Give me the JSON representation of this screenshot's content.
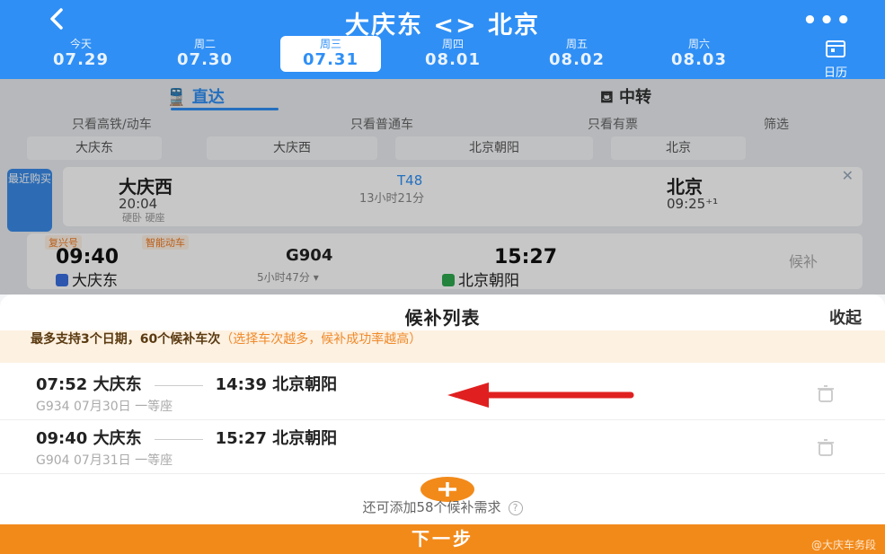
{
  "header": {
    "title": "大庆东 <> 北京",
    "more": "•••",
    "calendar_label": "日历",
    "dates": [
      {
        "weekday": "今天",
        "date": "07.29"
      },
      {
        "weekday": "周二",
        "date": "07.30"
      },
      {
        "weekday": "周三",
        "date": "07.31",
        "active": true
      },
      {
        "weekday": "周四",
        "date": "08.01"
      },
      {
        "weekday": "周五",
        "date": "08.02"
      },
      {
        "weekday": "周六",
        "date": "08.03"
      }
    ]
  },
  "background": {
    "tab_direct": "直达",
    "tab_transfer": "中转",
    "filters": [
      "只看高铁/动车",
      "只看普通车",
      "只看有票",
      "筛选"
    ],
    "stations": [
      "大庆东",
      "大庆西",
      "北京朝阳",
      "北京"
    ],
    "recent_label": "最近购买",
    "card1": {
      "from": "大庆西",
      "from_time": "20:04",
      "train": "T48",
      "duration": "13小时21分",
      "to": "北京",
      "to_time": "09:25⁺¹",
      "tags": "硬卧 硬座"
    },
    "card2": {
      "badge1": "复兴号",
      "badge2": "智能动车",
      "dep_time": "09:40",
      "dep_station": "大庆东",
      "train": "G904",
      "duration": "5小时47分",
      "arr_time": "15:27",
      "arr_station": "北京朝阳",
      "fallback": "候补"
    }
  },
  "sheet": {
    "title": "候补列表",
    "collapse": "收起",
    "notice_main": "最多支持3个日期，60个候补车次",
    "notice_hint": "（选择车次越多，候补成功率越高）",
    "items": [
      {
        "dep_time": "07:52",
        "dep_station": "大庆东",
        "arr_time": "14:39",
        "arr_station": "北京朝阳",
        "detail": "G934  07月30日  一等座"
      },
      {
        "dep_time": "09:40",
        "dep_station": "大庆东",
        "arr_time": "15:27",
        "arr_station": "北京朝阳",
        "detail": "G904  07月31日  一等座"
      }
    ],
    "add_text": "还可添加58个候补需求",
    "help": "?",
    "next": "下一步",
    "watermark": "@大庆车务段"
  },
  "colors": {
    "primary": "#2f8ff5",
    "accent": "#f28a1a",
    "arrow": "#e02020"
  }
}
